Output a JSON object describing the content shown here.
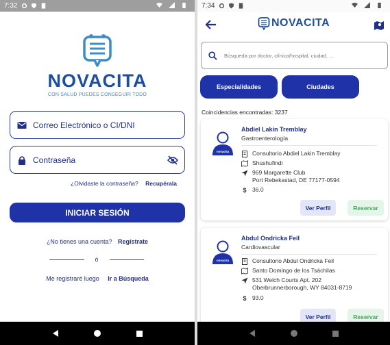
{
  "login": {
    "status": {
      "time": "7:32"
    },
    "brand": "NOVACITA",
    "tagline": "CON SALUD PUEDES CONSEGUIR TODO",
    "email_placeholder": "Correo Electrónico o CI/DNI",
    "password_placeholder": "Contraseña",
    "forgot_text": "¿Olvidaste la contraseña?",
    "forgot_link": "Recupérala",
    "login_button": "INICIAR SESIÓN",
    "no_account_text": "¿No tienes una cuenta?",
    "register_link": "Regístrate",
    "or_text": "ó",
    "later_text": "Me registraré luego",
    "search_link": "Ir a Búsqueda"
  },
  "search": {
    "status": {
      "time": "7:34"
    },
    "brand": "NOVACITA",
    "search_placeholder": "Búsqueda por doctor, clínica/hospital, ciudad, ...",
    "filters": [
      "Especialidades",
      "Ciudades"
    ],
    "matches_label": "Coincidencias encontradas: 3237",
    "results": [
      {
        "name": "Abdiel Lakin Tremblay",
        "specialty": "Gastroenterología",
        "office": "Consultorio Abdiel Lakin Tremblay",
        "city": "Shushufindi",
        "address_line1": "969 Margarette Club",
        "address_line2": "Port Rebekastad, DE 77177-0594",
        "price": "36.0"
      },
      {
        "name": "Abdul Ondricka Feil",
        "specialty": "Cardiovascular",
        "office": "Consultorio Abdul Ondricka Feil",
        "city": "Santo Domingo de los Tsáchilas",
        "address_line1": "531 Welch Courts Apt. 202",
        "address_line2": "Oberbrunnerborough, WY 84031-8719",
        "price": "93.0"
      }
    ],
    "profile_button": "Ver Perfil",
    "book_button": "Reservar"
  },
  "avatar_label": "novacita",
  "colors": {
    "primary": "#2032a8",
    "brand": "#1e4f9c",
    "accent": "#3c8cc8",
    "success": "#45a05a"
  }
}
